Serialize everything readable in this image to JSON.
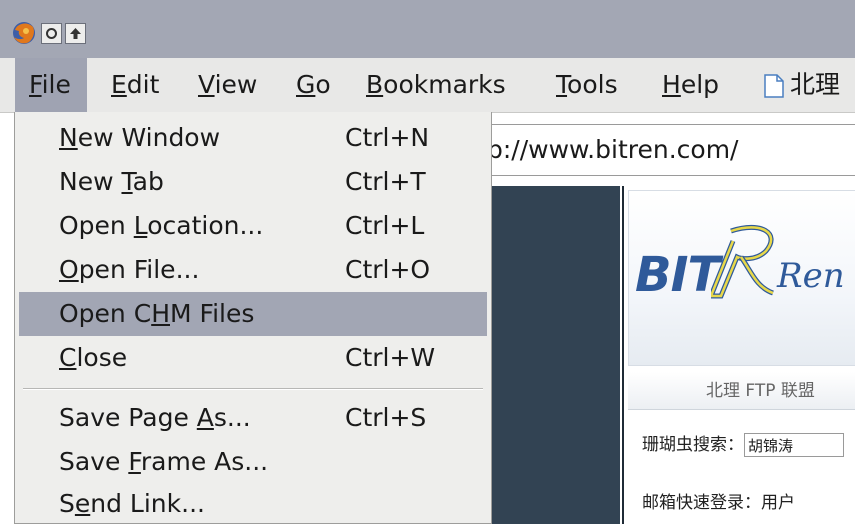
{
  "titlebar": {
    "browser_icon": "firefox-logo-icon",
    "buttons": [
      "minimize-icon",
      "maximize-icon"
    ]
  },
  "menubar": {
    "items": [
      {
        "label": "File",
        "mnemonic": "F",
        "rest": "ile",
        "active": true
      },
      {
        "label": "Edit",
        "mnemonic": "E",
        "rest": "dit"
      },
      {
        "label": "View",
        "mnemonic": "V",
        "rest": "iew"
      },
      {
        "label": "Go",
        "mnemonic": "G",
        "rest": "o"
      },
      {
        "label": "Bookmarks",
        "mnemonic": "B",
        "rest": "ookmarks"
      },
      {
        "label": "Tools",
        "mnemonic": "T",
        "rest": "ools"
      },
      {
        "label": "Help",
        "mnemonic": "H",
        "rest": "elp"
      }
    ],
    "bookmark_label": "北理"
  },
  "address_bar": {
    "value": "p://www.bitren.com/"
  },
  "page": {
    "logo_text": "BIT",
    "logo_script": "Ren",
    "strip_text": "北理 FTP 联盟",
    "search_label": "珊瑚虫搜索：",
    "search_value": "胡锦涛",
    "email_label": "邮箱快速登录：用户"
  },
  "file_menu": {
    "items": [
      {
        "pre": "",
        "mn": "N",
        "post": "ew Window",
        "accel": "Ctrl+N"
      },
      {
        "pre": "New ",
        "mn": "T",
        "post": "ab",
        "accel": "Ctrl+T"
      },
      {
        "pre": "Open ",
        "mn": "L",
        "post": "ocation...",
        "accel": "Ctrl+L"
      },
      {
        "pre": "",
        "mn": "O",
        "post": "pen File...",
        "accel": "Ctrl+O"
      },
      {
        "pre": "Open C",
        "mn": "H",
        "post": "M Files",
        "accel": "",
        "highlighted": true
      },
      {
        "pre": "",
        "mn": "C",
        "post": "lose",
        "accel": "Ctrl+W"
      },
      {
        "pre": "Save Page ",
        "mn": "A",
        "post": "s...",
        "accel": "Ctrl+S"
      },
      {
        "pre": "Save ",
        "mn": "F",
        "post": "rame As...",
        "accel": ""
      },
      {
        "pre": "S",
        "mn": "e",
        "post": "nd Link...",
        "accel": ""
      }
    ]
  },
  "colors": {
    "titlebar": "#a3a7b4",
    "menu_bg": "#eeeeec",
    "highlight": "#a2a6b4",
    "dark_sidebar": "#324353",
    "logo_blue": "#2f5a9a",
    "logo_yellow": "#e8d84a"
  }
}
